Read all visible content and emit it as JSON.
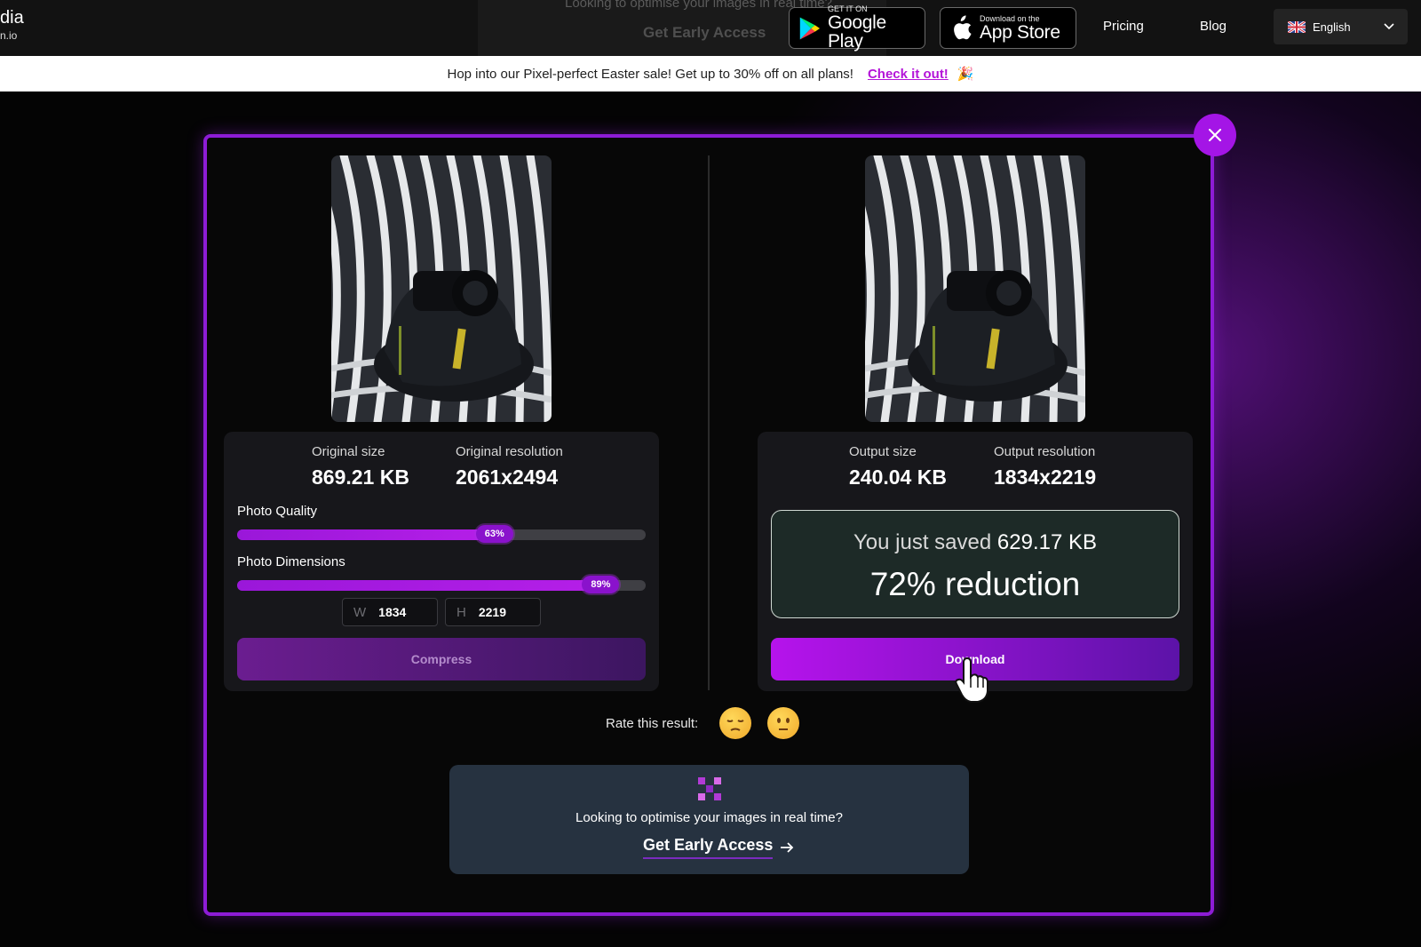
{
  "brand": {
    "line1": "dia",
    "line2": "n.io"
  },
  "header_banner": {
    "question": "Looking to optimise your images in real time?",
    "cta": "Get Early Access"
  },
  "stores": {
    "google": {
      "small": "GET IT ON",
      "big": "Google Play"
    },
    "apple": {
      "small": "Download on the",
      "big": "App Store"
    }
  },
  "nav": {
    "pricing": "Pricing",
    "blog": "Blog",
    "language": "English"
  },
  "promo": {
    "text": "Hop into our Pixel-perfect Easter sale! Get up to 30% off on all plans!",
    "link": "Check it out!",
    "emoji": "🎉"
  },
  "original": {
    "size_label": "Original size",
    "size_value": "869.21 KB",
    "res_label": "Original resolution",
    "res_value": "2061x2494"
  },
  "controls": {
    "quality_label": "Photo Quality",
    "quality_value": 63,
    "quality_text": "63%",
    "dimensions_label": "Photo Dimensions",
    "dimensions_value": 89,
    "dimensions_text": "89%",
    "width_key": "W",
    "width_value": "1834",
    "height_key": "H",
    "height_value": "2219",
    "compress_label": "Compress"
  },
  "output": {
    "size_label": "Output size",
    "size_value": "240.04 KB",
    "res_label": "Output resolution",
    "res_value": "1834x2219",
    "saved_prefix": "You just saved",
    "saved_value": "629.17 KB",
    "reduction": "72% reduction",
    "download_label": "Download"
  },
  "rating": {
    "label": "Rate this result:"
  },
  "early_access": {
    "question": "Looking to optimise your images in real time?",
    "cta": "Get Early Access"
  },
  "colors": {
    "accent": "#a415e6",
    "modal_border": "#8d1cd6",
    "link": "#b414d8"
  }
}
